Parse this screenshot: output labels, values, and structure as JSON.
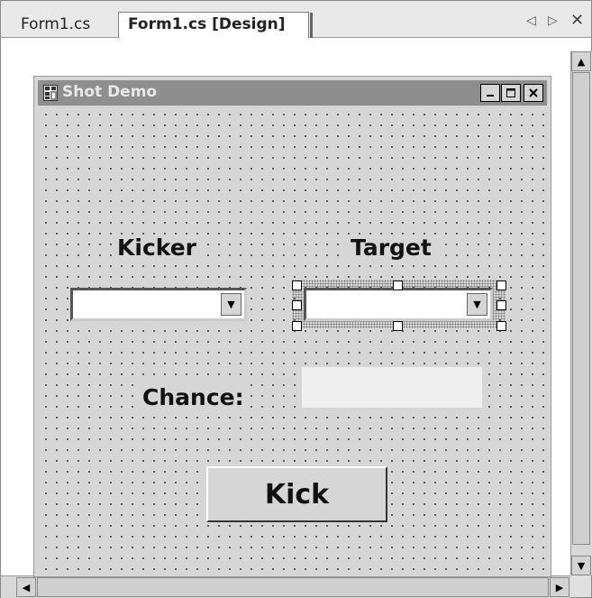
{
  "tabs": [
    {
      "label": "Form1.cs",
      "active": false
    },
    {
      "label": "Form1.cs [Design]",
      "active": true
    }
  ],
  "tab_nav": {
    "prev_icon": "triangle-left",
    "next_icon": "triangle-right",
    "close_icon": "close-x"
  },
  "form": {
    "title": "Shot Demo",
    "labels": {
      "kicker": "Kicker",
      "target": "Target",
      "chance": "Chance:"
    },
    "kicker_combo_value": "",
    "target_combo_value": "",
    "chance_value": "",
    "kick_button": "Kick"
  },
  "colors": {
    "title_bar": "#8e8e8e",
    "form_back": "#d6d6d6",
    "selection_handle": "#ffffff"
  }
}
